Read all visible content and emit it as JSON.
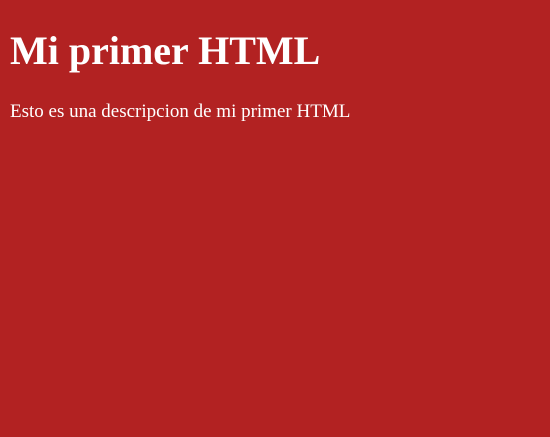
{
  "colors": {
    "background": "#b22222",
    "text": "#ffffff"
  },
  "page": {
    "heading": "Mi primer HTML",
    "description": "Esto es una descripcion de mi primer HTML"
  }
}
